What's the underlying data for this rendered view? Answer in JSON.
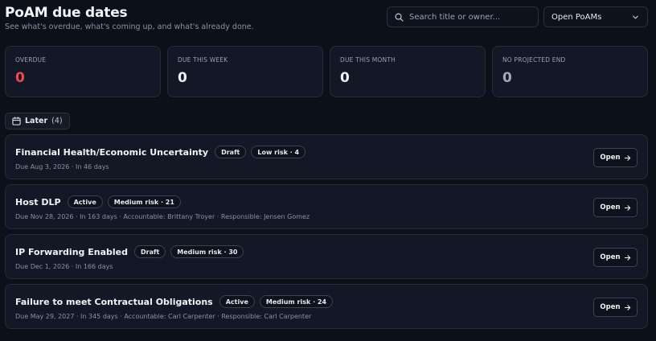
{
  "header": {
    "title": "PoAM due dates",
    "subtitle": "See what's overdue, what's coming up, and what's already done."
  },
  "search": {
    "placeholder": "Search title or owner...",
    "value": ""
  },
  "filter": {
    "selected": "Open PoAMs"
  },
  "stats": [
    {
      "label": "OVERDUE",
      "value": "0"
    },
    {
      "label": "DUE THIS WEEK",
      "value": "0"
    },
    {
      "label": "DUE THIS MONTH",
      "value": "0"
    },
    {
      "label": "NO PROJECTED END",
      "value": "0"
    }
  ],
  "group": {
    "label": "Later",
    "count": "(4)"
  },
  "items": [
    {
      "title": "Financial Health/Economic Uncertainty",
      "status": "Draft",
      "risk": "Low risk · 4",
      "meta": "Due Aug 3, 2026 · In 46 days",
      "action": "Open"
    },
    {
      "title": "Host DLP",
      "status": "Active",
      "risk": "Medium risk · 21",
      "meta": "Due Nov 28, 2026 · In 163 days · Accountable: Brittany Troyer · Responsible: Jensen Gomez",
      "action": "Open"
    },
    {
      "title": "IP Forwarding Enabled",
      "status": "Draft",
      "risk": "Medium risk · 30",
      "meta": "Due Dec 1, 2026 · In 166 days",
      "action": "Open"
    },
    {
      "title": "Failure to meet Contractual Obligations",
      "status": "Active",
      "risk": "Medium risk · 24",
      "meta": "Due May 29, 2027 · In 345 days · Accountable: Carl Carpenter · Responsible: Carl Carpenter",
      "action": "Open"
    }
  ],
  "colors": {
    "background": "#0b1019",
    "card": "#121825",
    "overdue": "#ee4b4f"
  }
}
